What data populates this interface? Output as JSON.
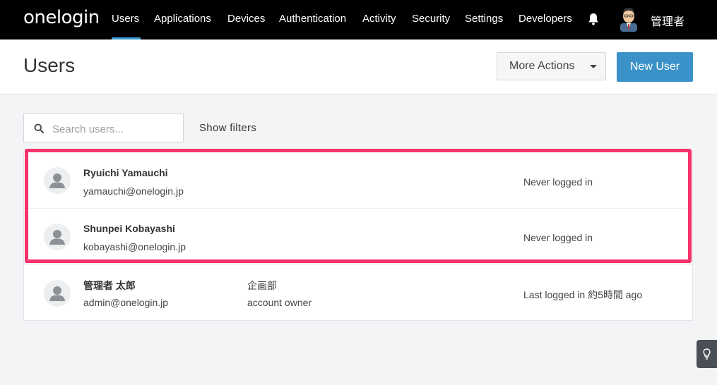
{
  "app": {
    "logo": "onelogin",
    "nav": [
      "Users",
      "Applications",
      "Devices",
      "Authentication",
      "Activity",
      "Security",
      "Settings",
      "Developers"
    ],
    "active_nav": "Users",
    "current_user": "管理者",
    "icons": {
      "bell": "bell-icon",
      "avatar": "admin-avatar-icon"
    },
    "accent_color": "#3b9ad6"
  },
  "header": {
    "title": "Users",
    "more_actions_label": "More Actions",
    "new_user_label": "New User"
  },
  "search": {
    "placeholder": "Search users...",
    "value": "",
    "show_filters_label": "Show filters"
  },
  "users": [
    {
      "name": "Ryuichi Yamauchi",
      "email": "yamauchi@onelogin.jp",
      "department": "",
      "role": "",
      "status": "Never logged in"
    },
    {
      "name": "Shunpei Kobayashi",
      "email": "kobayashi@onelogin.jp",
      "department": "",
      "role": "",
      "status": "Never logged in"
    },
    {
      "name": "管理者 太郎",
      "email": "admin@onelogin.jp",
      "department": "企画部",
      "role": "account owner",
      "status": "Last logged in 約5時間 ago"
    }
  ],
  "highlight_color": "#f5336b"
}
